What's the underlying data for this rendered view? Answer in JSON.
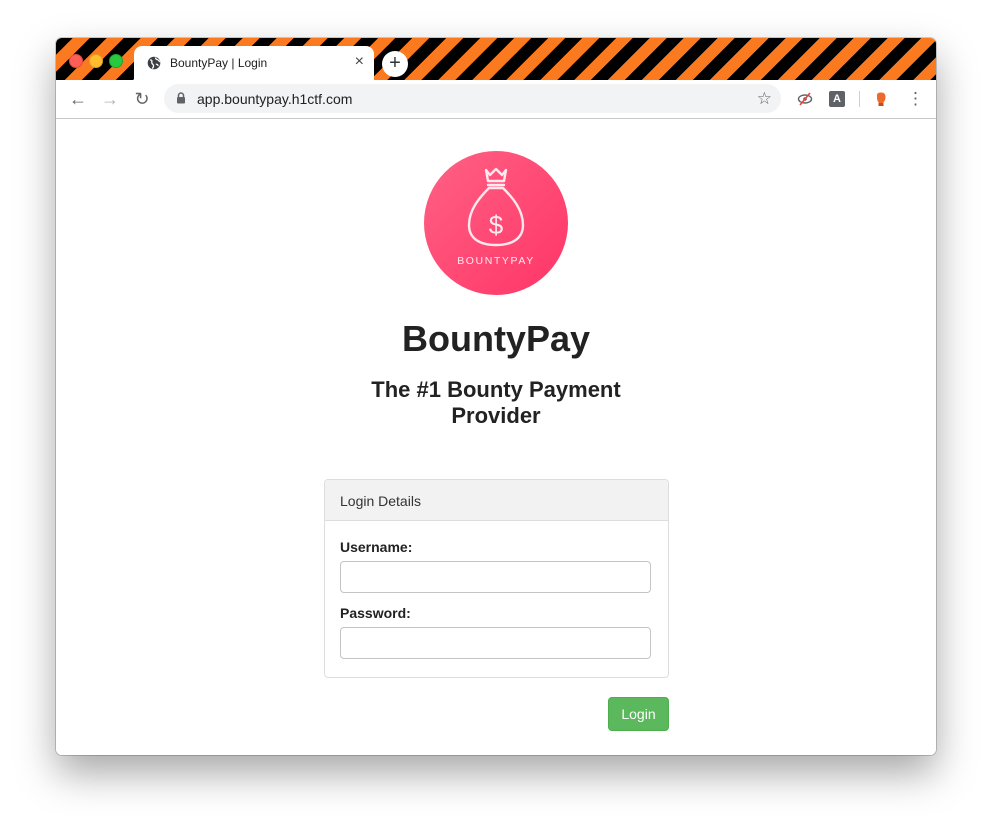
{
  "browser": {
    "tab_title": "BountyPay | Login",
    "tab_close": "×",
    "new_tab": "+",
    "url": "app.bountypay.h1ctf.com",
    "back": "←",
    "forward": "→",
    "reload": "↻",
    "bookmark_star": "☆",
    "extension_a": "A",
    "menu": "⋮"
  },
  "logo": {
    "text": "BOUNTYPAY",
    "symbol": "$",
    "colors": {
      "start": "#ff5a7a",
      "end": "#ff3b6b",
      "line": "#ffe9ee"
    }
  },
  "page": {
    "brand": "BountyPay",
    "tagline_line1": "The #1 Bounty Payment",
    "tagline_line2": "Provider"
  },
  "login": {
    "panel_title": "Login Details",
    "username_label": "Username:",
    "username_value": "",
    "password_label": "Password:",
    "password_value": "",
    "submit_label": "Login"
  },
  "colors": {
    "stripe_orange": "#fb7a1f",
    "stripe_black": "#000000",
    "button_green": "#5cb85c"
  },
  "icons": [
    "globe-icon",
    "close-icon",
    "plus-icon",
    "back-arrow-icon",
    "forward-arrow-icon",
    "reload-icon",
    "lock-icon",
    "star-icon",
    "eye-slash-icon",
    "a-extension-icon",
    "glove-icon",
    "menu-dots-icon",
    "money-bag-icon"
  ]
}
